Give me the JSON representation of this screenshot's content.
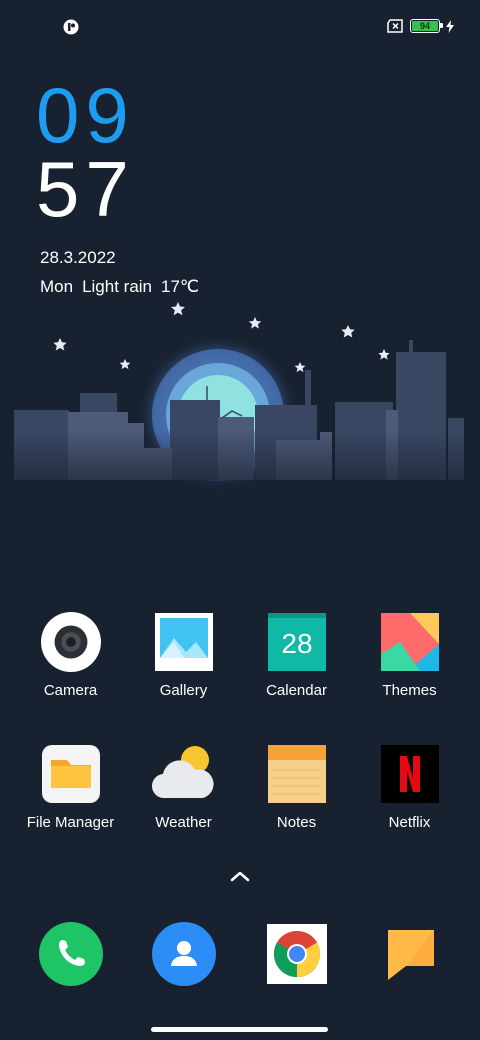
{
  "status_bar": {
    "left_icon": "notification-app-icon",
    "sim_icon": "no-sim-icon",
    "battery_level": "94",
    "charging_icon": "lightning-bolt-icon"
  },
  "clock": {
    "hour": "09",
    "minute": "57"
  },
  "date": "28.3.2022",
  "weather": {
    "day": "Mon",
    "condition": "Light rain",
    "temperature": "17℃"
  },
  "apps": [
    {
      "label": "Camera",
      "icon": "camera-icon"
    },
    {
      "label": "Gallery",
      "icon": "gallery-icon"
    },
    {
      "label": "Calendar",
      "icon": "calendar-icon",
      "badge": "28"
    },
    {
      "label": "Themes",
      "icon": "themes-icon"
    },
    {
      "label": "File Manager",
      "icon": "file-manager-icon"
    },
    {
      "label": "Weather",
      "icon": "weather-icon"
    },
    {
      "label": "Notes",
      "icon": "notes-icon"
    },
    {
      "label": "Netflix",
      "icon": "netflix-icon",
      "badge": "N"
    }
  ],
  "dock": [
    {
      "icon": "phone-icon"
    },
    {
      "icon": "contacts-icon"
    },
    {
      "icon": "chrome-icon"
    },
    {
      "icon": "messages-icon"
    }
  ],
  "colors": {
    "background": "#172130",
    "clock_hour": "#1e9cf0",
    "accent_green": "#33c24a"
  }
}
